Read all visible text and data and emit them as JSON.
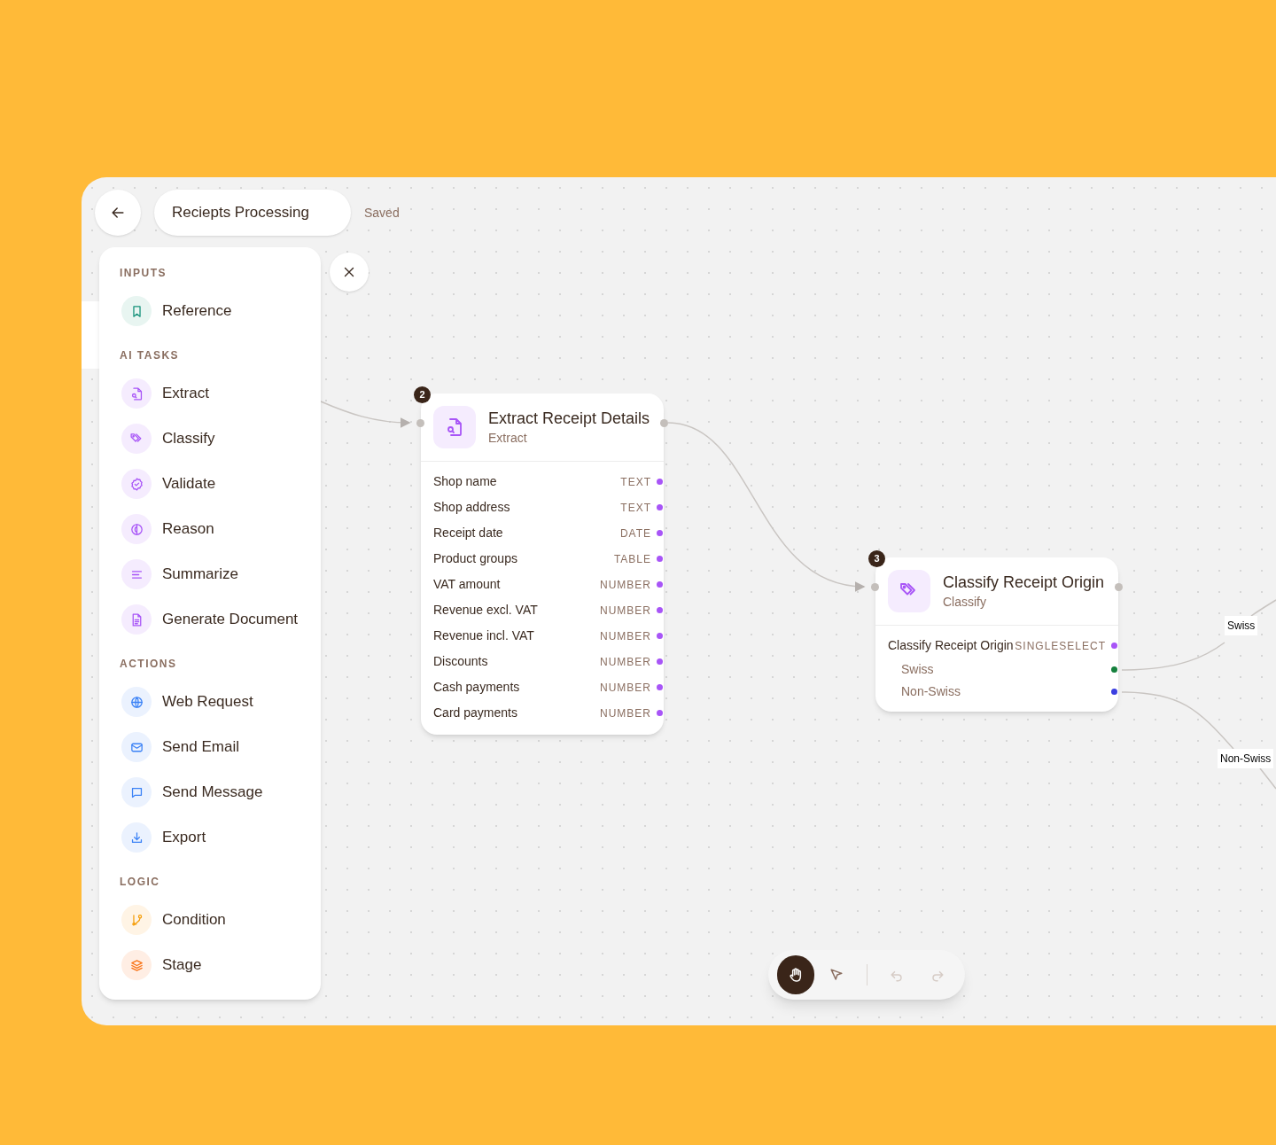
{
  "header": {
    "title": "Reciepts Processing",
    "status": "Saved"
  },
  "sidebar": {
    "sections": [
      {
        "title": "INPUTS",
        "items": [
          {
            "label": "Reference"
          }
        ]
      },
      {
        "title": "AI TASKS",
        "items": [
          {
            "label": "Extract"
          },
          {
            "label": "Classify"
          },
          {
            "label": "Validate"
          },
          {
            "label": "Reason"
          },
          {
            "label": "Summarize"
          },
          {
            "label": "Generate Document"
          }
        ]
      },
      {
        "title": "ACTIONS",
        "items": [
          {
            "label": "Web Request"
          },
          {
            "label": "Send Email"
          },
          {
            "label": "Send Message"
          },
          {
            "label": "Export"
          }
        ]
      },
      {
        "title": "LOGIC",
        "items": [
          {
            "label": "Condition"
          },
          {
            "label": "Stage"
          }
        ]
      }
    ]
  },
  "nodes": [
    {
      "number": "2",
      "title": "Extract Receipt Details",
      "subtitle": "Extract",
      "fields": [
        {
          "label": "Shop name",
          "type": "TEXT"
        },
        {
          "label": "Shop address",
          "type": "TEXT"
        },
        {
          "label": "Receipt date",
          "type": "DATE"
        },
        {
          "label": "Product groups",
          "type": "TABLE"
        },
        {
          "label": "VAT amount",
          "type": "NUMBER"
        },
        {
          "label": "Revenue excl. VAT",
          "type": "NUMBER"
        },
        {
          "label": "Revenue incl. VAT",
          "type": "NUMBER"
        },
        {
          "label": "Discounts",
          "type": "NUMBER"
        },
        {
          "label": "Cash payments",
          "type": "NUMBER"
        },
        {
          "label": "Card payments",
          "type": "NUMBER"
        }
      ]
    },
    {
      "number": "3",
      "title": "Classify Receipt Origin",
      "subtitle": "Classify",
      "fields": [
        {
          "label": "Classify Receipt Origin",
          "type": "SINGLESELECT"
        }
      ],
      "options": [
        {
          "label": "Swiss",
          "color": "#15803d"
        },
        {
          "label": "Non-Swiss",
          "color": "#3b3fe0"
        }
      ]
    }
  ],
  "edge_labels": [
    "Swiss",
    "Non-Swiss"
  ],
  "toolbar": {
    "tools": [
      {
        "kind": "hand",
        "selected": true
      },
      {
        "kind": "pointer",
        "selected": false
      }
    ],
    "history": [
      {
        "kind": "undo",
        "disabled": true
      },
      {
        "kind": "redo",
        "disabled": true
      }
    ]
  }
}
